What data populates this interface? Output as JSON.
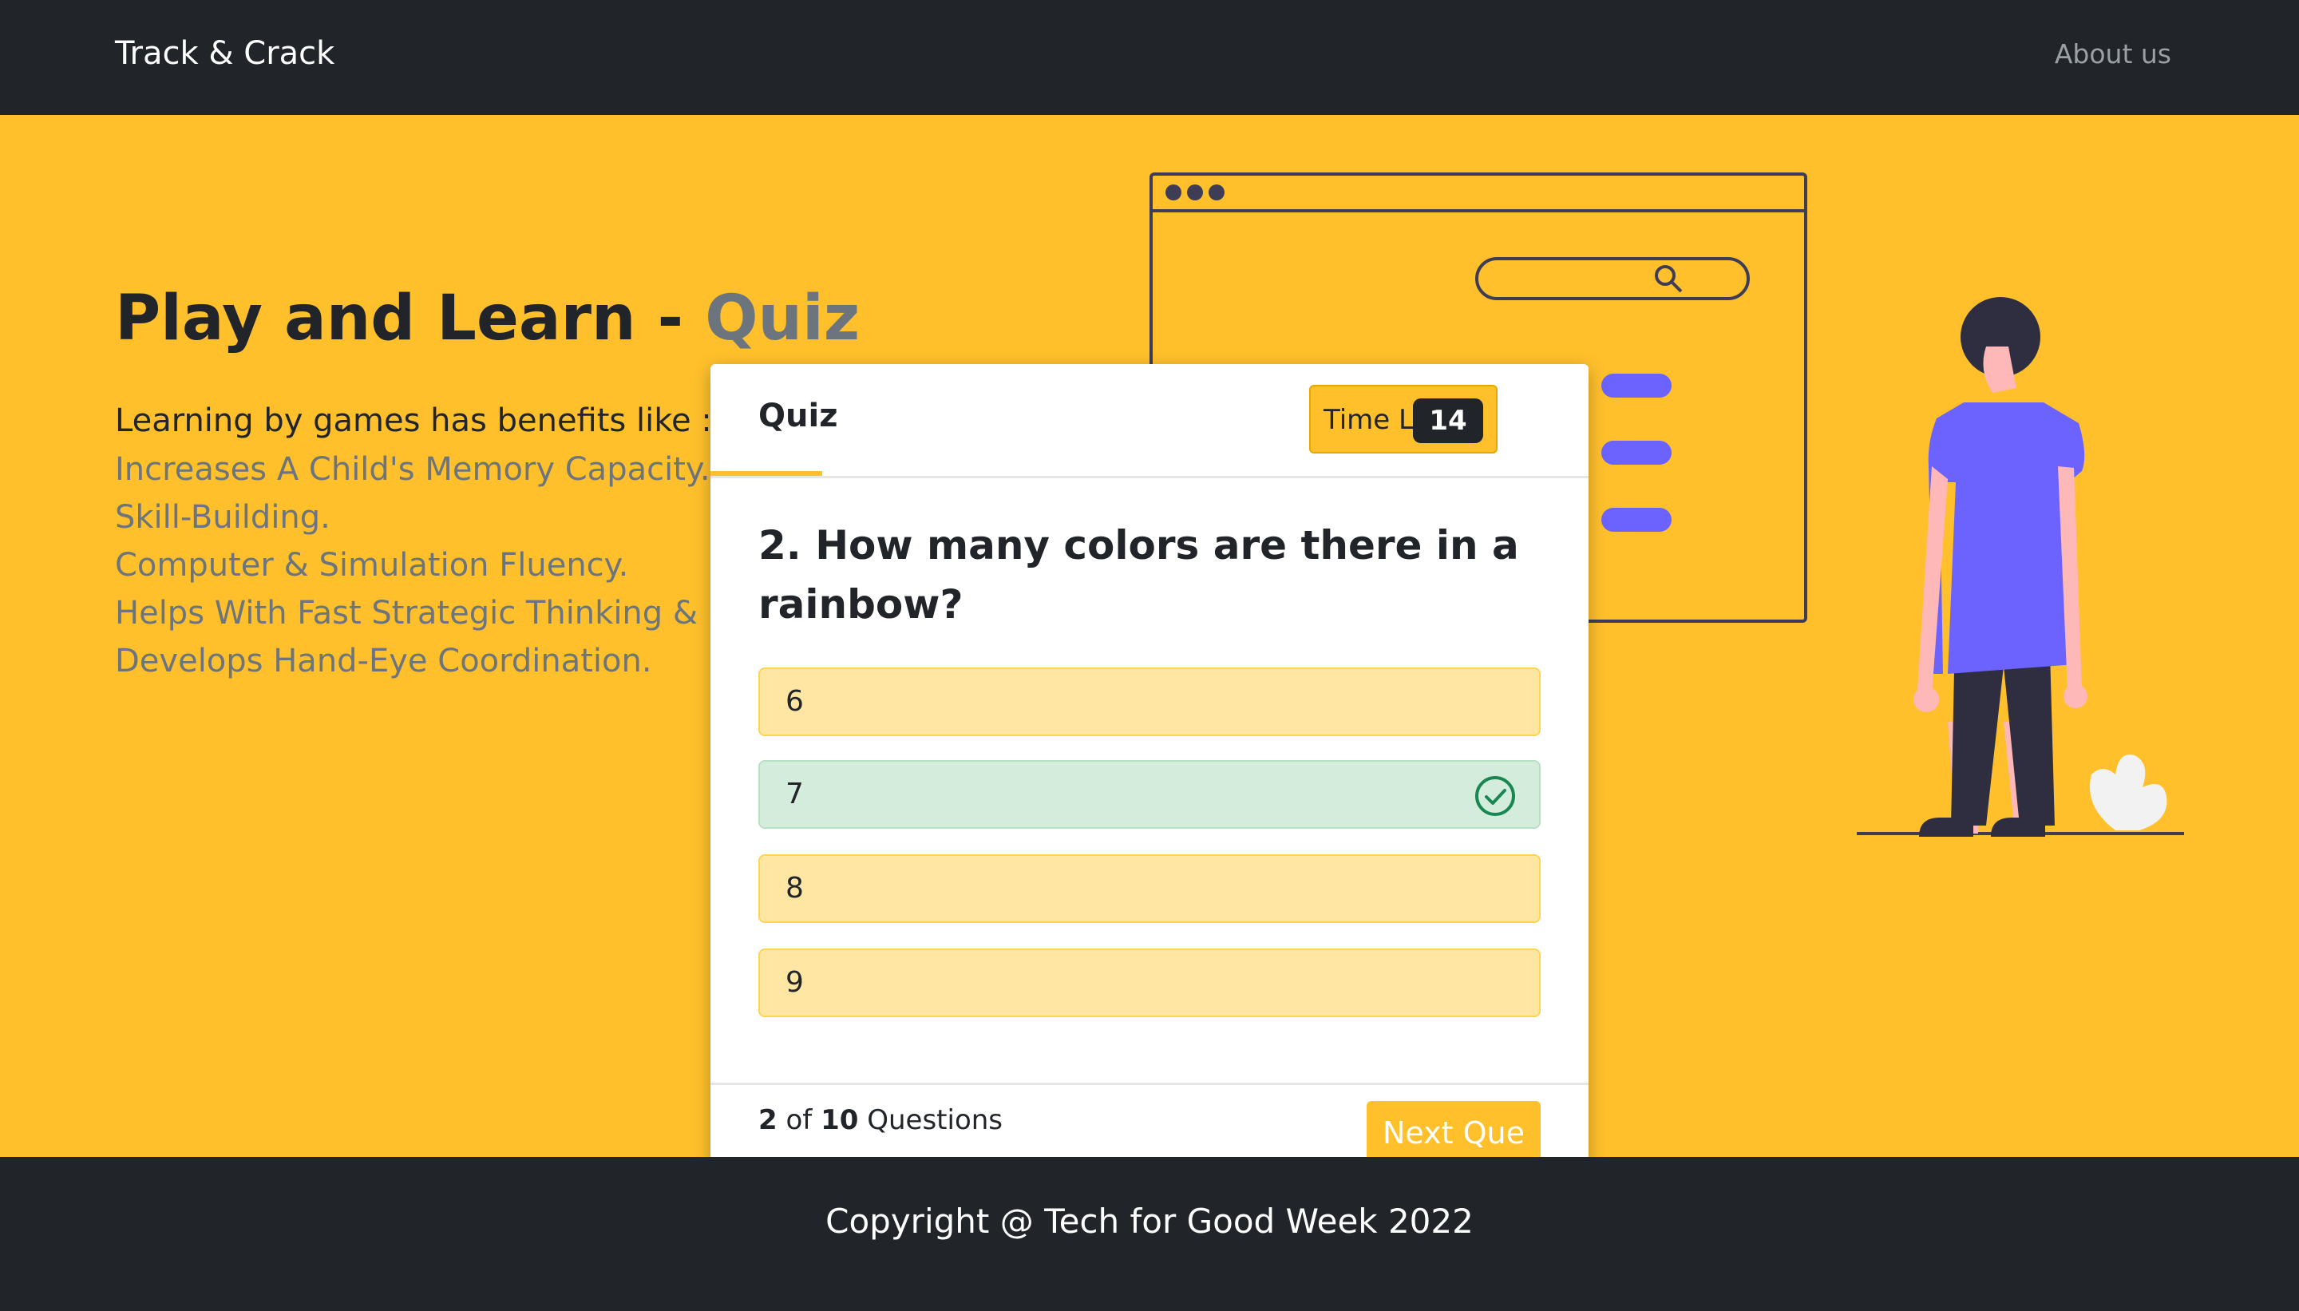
{
  "navbar": {
    "brand": "Track & Crack",
    "about_link": "About us"
  },
  "hero": {
    "title_main": "Play and Learn - ",
    "title_accent": "Quiz",
    "intro": "Learning by games has benefits like :",
    "benefits": [
      "Increases A Child's Memory Capacity.",
      "Skill-Building.",
      "Computer & Simulation Fluency.",
      "Helps With Fast Strategic Thinking & Problem-Solving.",
      "Develops Hand-Eye Coordination."
    ]
  },
  "quiz": {
    "tab_label": "Quiz",
    "timer_label": "Time Left",
    "timer_value": "14",
    "question": "2. How many colors are there in a rainbow?",
    "options": [
      {
        "label": "6",
        "state": "default"
      },
      {
        "label": "7",
        "state": "correct"
      },
      {
        "label": "8",
        "state": "default"
      },
      {
        "label": "9",
        "state": "default"
      }
    ],
    "progress": {
      "current": "2",
      "of": "of",
      "total": "10",
      "suffix": "Questions"
    },
    "next_label": "Next Que"
  },
  "footer": {
    "copyright": "Copyright @ Tech for Good Week 2022"
  },
  "colors": {
    "accent": "#ffc02c",
    "dark": "#212529",
    "muted": "#6c757d",
    "correct_bg": "#d4ecdc",
    "correct_icon": "#198754",
    "illustration_purple": "#6c63ff"
  },
  "icons": {
    "correct_option": "check-circle-icon",
    "search": "search-icon"
  }
}
